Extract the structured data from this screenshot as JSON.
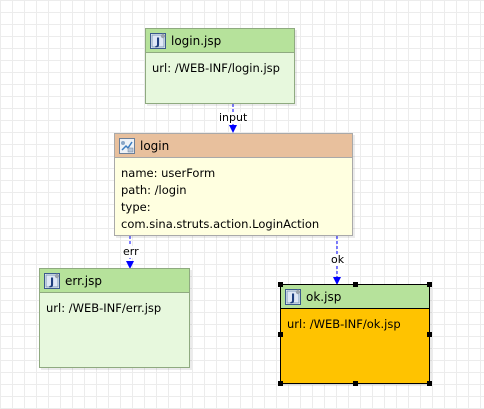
{
  "nodes": {
    "login_jsp": {
      "title": "login.jsp",
      "props": [
        "url: /WEB-INF/login.jsp"
      ]
    },
    "login_action": {
      "title": "login",
      "props": [
        "name: userForm",
        "path: /login",
        "type: com.sina.struts.action.LoginAction"
      ]
    },
    "err_jsp": {
      "title": "err.jsp",
      "props": [
        "url: /WEB-INF/err.jsp"
      ]
    },
    "ok_jsp": {
      "title": "ok.jsp",
      "props": [
        "url: /WEB-INF/ok.jsp"
      ]
    }
  },
  "edges": {
    "input": "input",
    "err": "err",
    "ok": "ok"
  },
  "colors": {
    "jsp_header": "#b6e29b",
    "jsp_body": "#e7f8dd",
    "action_header": "#e8c09d",
    "action_body": "#ffffe0",
    "selected_body": "#ffc300",
    "edge": "#0000ff"
  },
  "icons": {
    "jsp": "jsp-file-icon",
    "action": "action-mapping-icon"
  },
  "selected_node": "ok_jsp"
}
